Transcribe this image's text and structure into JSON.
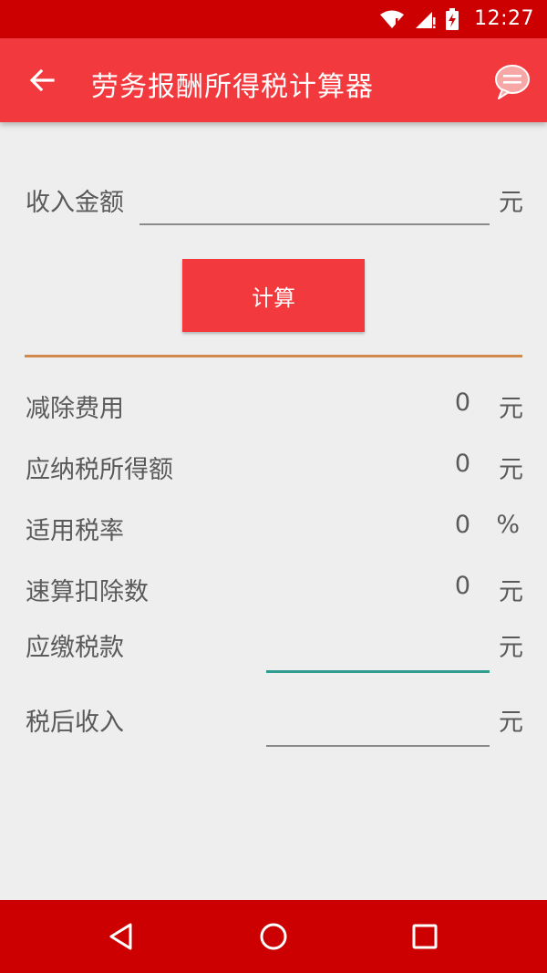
{
  "status": {
    "time": "12:27"
  },
  "appbar": {
    "title": "劳务报酬所得税计算器"
  },
  "income": {
    "label": "收入金额",
    "value": "",
    "unit": "元"
  },
  "calculate_label": "计算",
  "results": [
    {
      "label": "减除费用",
      "value": "0",
      "unit": "元"
    },
    {
      "label": "应纳税所得额",
      "value": "0",
      "unit": "元"
    },
    {
      "label": "适用税率",
      "value": "0",
      "unit": "%"
    },
    {
      "label": "速算扣除数",
      "value": "0",
      "unit": "元"
    }
  ],
  "tax_payable": {
    "label": "应缴税款",
    "value": "",
    "unit": "元"
  },
  "after_tax": {
    "label": "税后收入",
    "value": "",
    "unit": "元"
  },
  "colors": {
    "status_bar": "#cc0000",
    "app_bar": "#f2393e",
    "accent_divider": "#d28a4a",
    "focus_line": "#2e9c8f"
  }
}
